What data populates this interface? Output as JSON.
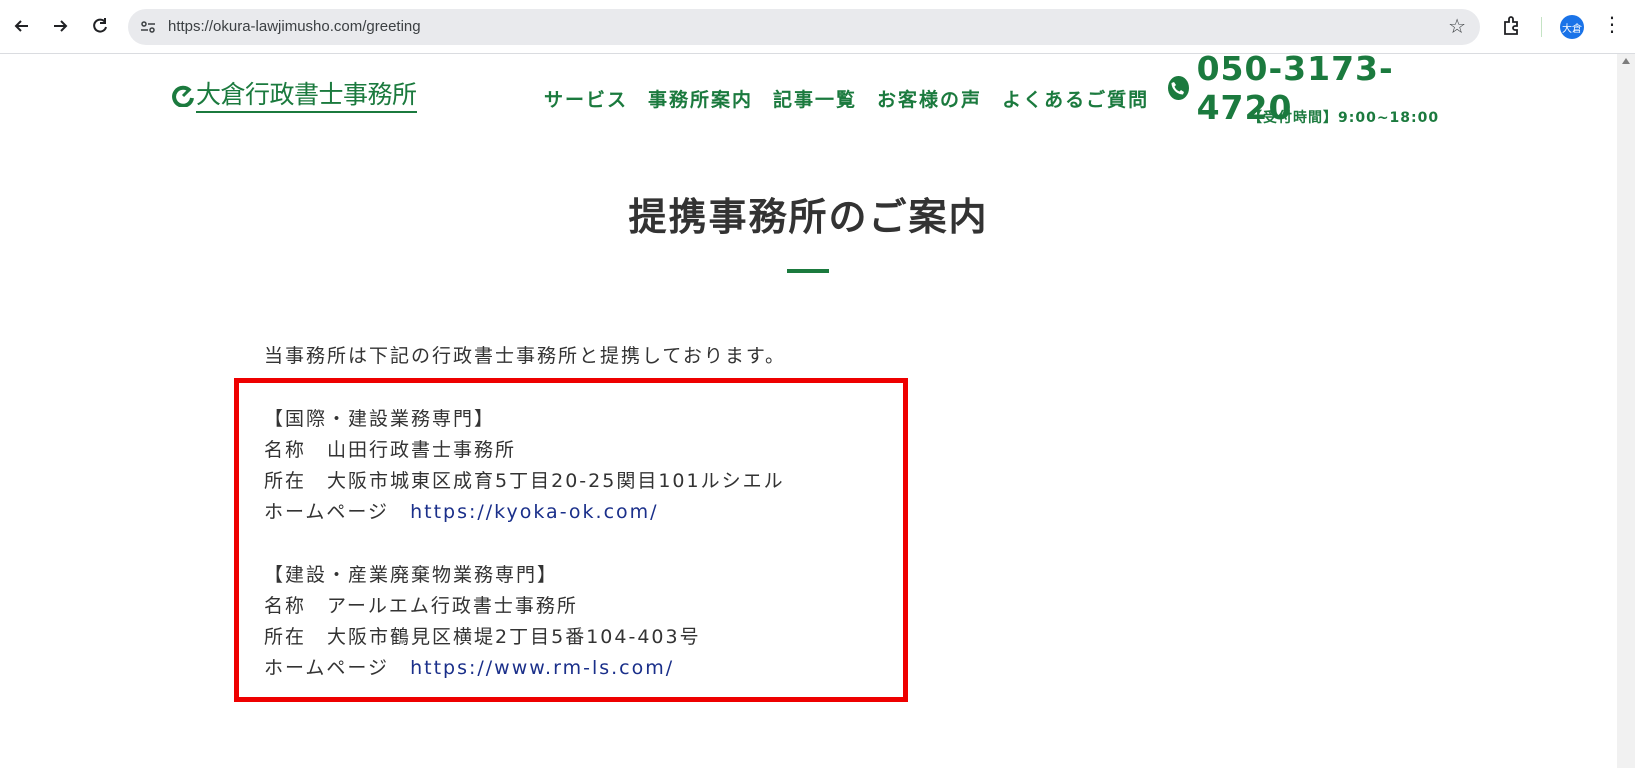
{
  "browser": {
    "url": "https://okura-lawjimusho.com/greeting",
    "profile_initials": "大倉"
  },
  "site": {
    "logo": {
      "part1": "大倉",
      "part2": "行政書士事務所"
    },
    "nav": [
      "サービス",
      "事務所案内",
      "記事一覧",
      "お客様の声",
      "よくあるご質問"
    ],
    "phone": "050-3173-4720",
    "hours": "【受付時間】9:00~18:00"
  },
  "main": {
    "title": "提携事務所のご案内",
    "intro": "当事務所は下記の行政書士事務所と提携しております。",
    "offices": [
      {
        "category": "【国際・建設業務専門】",
        "name_label": "名称",
        "name": "山田行政書士事務所",
        "address_label": "所在",
        "address": "大阪市城東区成育5丁目20-25関目101ルシエル",
        "homepage_label": "ホームページ",
        "homepage": "https://kyoka-ok.com/"
      },
      {
        "category": "【建設・産業廃棄物業務専門】",
        "name_label": "名称",
        "name": "アールエム行政書士事務所",
        "address_label": "所在",
        "address": "大阪市鶴見区横堤2丁目5番104-403号",
        "homepage_label": "ホームページ",
        "homepage": "https://www.rm-ls.com/"
      }
    ]
  },
  "colors": {
    "brand_green": "#1b7a3e",
    "highlight_red": "#ee0000",
    "link_blue": "#1a2f8a"
  }
}
